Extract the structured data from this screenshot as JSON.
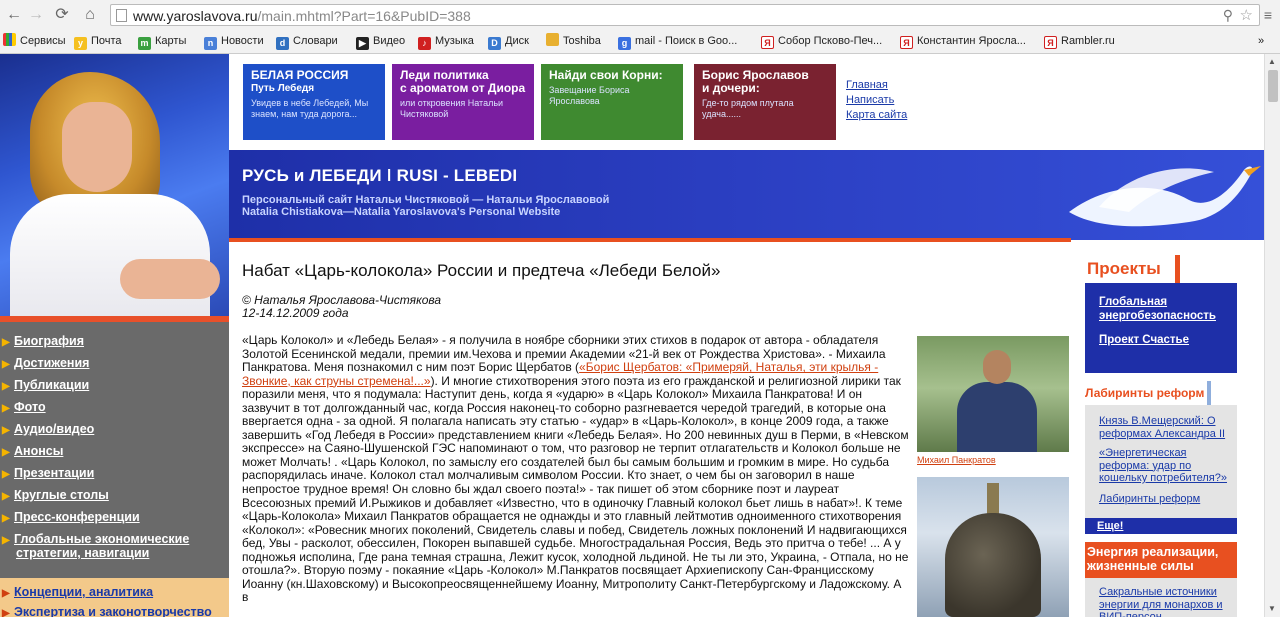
{
  "browser": {
    "url_host": "www.yaroslavova.ru",
    "url_path": "/main.mhtml?Part=16&PubID=388",
    "bookmarks": [
      "Сервисы",
      "Почта",
      "Карты",
      "Новости",
      "Словари",
      "Видео",
      "Музыка",
      "Диск",
      "Toshiba",
      "mail - Поиск в Goo...",
      "Собор Псково-Печ...",
      "Константин Яросла...",
      "Rambler.ru"
    ],
    "more": "»"
  },
  "promos": [
    {
      "title": "БЕЛАЯ РОССИЯ",
      "title2": "Путь Лебедя",
      "text": "Увидев в небе Лебедей, Мы знаем, нам туда дорога...",
      "color": "#1e4fc8"
    },
    {
      "title": "Леди политика",
      "title2": "с ароматом от Диора",
      "text": "или откровения Натальи Чистяковой",
      "color": "#7a1ea0"
    },
    {
      "title": "Найди свои Корни:",
      "title2": "",
      "text": "Завещание Бориса Ярославова",
      "color": "#3f8a30"
    },
    {
      "title": "Борис Ярославов",
      "title2": "и дочери:",
      "text": "Где-то рядом плутала удача......",
      "color": "#7a2230"
    }
  ],
  "toplinks": [
    "Главная",
    "Написать",
    "Карта сайта"
  ],
  "banner": {
    "title": "РУСЬ и ЛЕБЕДИ ǀ RUSI - LEBEDI",
    "sub1": "Персональный сайт Натальи Чистяковой — Натальи Ярославовой",
    "sub2": "Natalia Chistiakova—Natalia Yaroslavova's  Personal Website"
  },
  "leftnav": [
    "Биография",
    "Достижения",
    "Публикации",
    "Фото",
    "Аудио/видео",
    "Анонсы",
    "Презентации",
    "Круглые столы",
    "Пресс-конференции",
    "Глобальные экономические",
    "стратегии, навигации"
  ],
  "leftnav2": [
    "Концепции, аналитика",
    "Экспертиза и законотворчество"
  ],
  "article": {
    "title": "Набат «Царь-колокола» России и предтеча «Лебеди Белой»",
    "author": "© Наталья Ярославова-Чистякова",
    "date": "12-14.12.2009 года",
    "p1": "«Царь Колокол» и «Лебедь Белая» - я получила в ноябре сборники этих стихов в подарок от автора - обладателя Золотой Есенинской медали, премии им.Чехова и премии Академии «21-й век от Рождества Христова». - Михаила Панкратова. Меня познакомил с ним поэт Борис Щербатов (",
    "quote": "«Борис Щербатов: «Примеряй, Наталья, эти крылья - Звонкие, как струны стремена!...»",
    "p2": "). И многие стихотворения этого поэта из его гражданской и религиозной лирики так поразили меня, что я подумала: Наступит день, когда я «ударю» в «Царь Колокол» Михаила Панкратова! И он зазвучит в тот долгожданный час, когда Россия наконец-то соборно разгневается чередой трагедий, в которые она ввергается одна - за одной. Я полагала написать эту статью - «удар» в «Царь-Колокол», в конце 2009 года, а также завершить «Год Лебедя в России» представлением книги «Лебедь Белая». Но 200 невинных душ в Перми, в «Невском экспрессе» на Саяно-Шушенской ГЭС напоминают о том, что разговор не терпит отлагательств и Колокол больше не может Молчать! . «Царь Колокол, по замыслу его создателей был бы самым большим и громким в мире. Но судьба распорядилась иначе. Колокол стал молчаливым символом России. Кто знает, о чем бы он заговорил в наше непростое трудное время! Он словно бы ждал своего поэта!» - так пишет об этом сборнике поэт и лауреат Всесоюзных премий И.Рыжиков и добавляет «Известно, что в одиночку Главный колокол бьет лишь в набат»!. К теме «Царь-Колокола» Михаил Панкратов обращается не однажды и это главный лейтмотив одноименного стихотворения «Колокол»: «Ровесник многих поколений, Свидетель славы и побед, Свидетель ложных поклонений И надвигающихся бед, Увы - расколот, обессилен, Покорен выпавшей судьбе. Многострадальная Россия, Ведь это притча о тебе! ... А у подножья исполина, Где рана темная страшна, Лежит кусок, холодной льдиной. Не ты ли это, Украина, - Отпала, но не отошла?». Вторую поэму - покаяние «Царь -Колокол» М.Панкратов посвящает Архиепископу Сан-Францисскому Иоанну (кн.Шаховскому) и Высокопреосвященнейшему Иоанну, Митрополиту Санкт-Петербургскому и Ладожскому. А в",
    "photo_caption": "Михаил Панкратов"
  },
  "right": {
    "projects_head": "Проекты",
    "projects": [
      "Глобальная энергобезопасность",
      "Проект Счастье"
    ],
    "lab_head": "Лабиринты реформ",
    "lab_links": [
      "Князь В.Мещерский: О реформах Александра II",
      "«Энергетическая реформа: удар по кошельку потребителя?»",
      "Лабиринты реформ"
    ],
    "more": "Еще!",
    "energy_head": "Энергия реализации, жизненные силы",
    "energy_link": "Сакральные источники энергии для монархов и ВИП-персон"
  },
  "colors": {
    "accent": "#e85020",
    "navy": "#1e2fa8",
    "nav_grey": "#6a6a6a"
  }
}
